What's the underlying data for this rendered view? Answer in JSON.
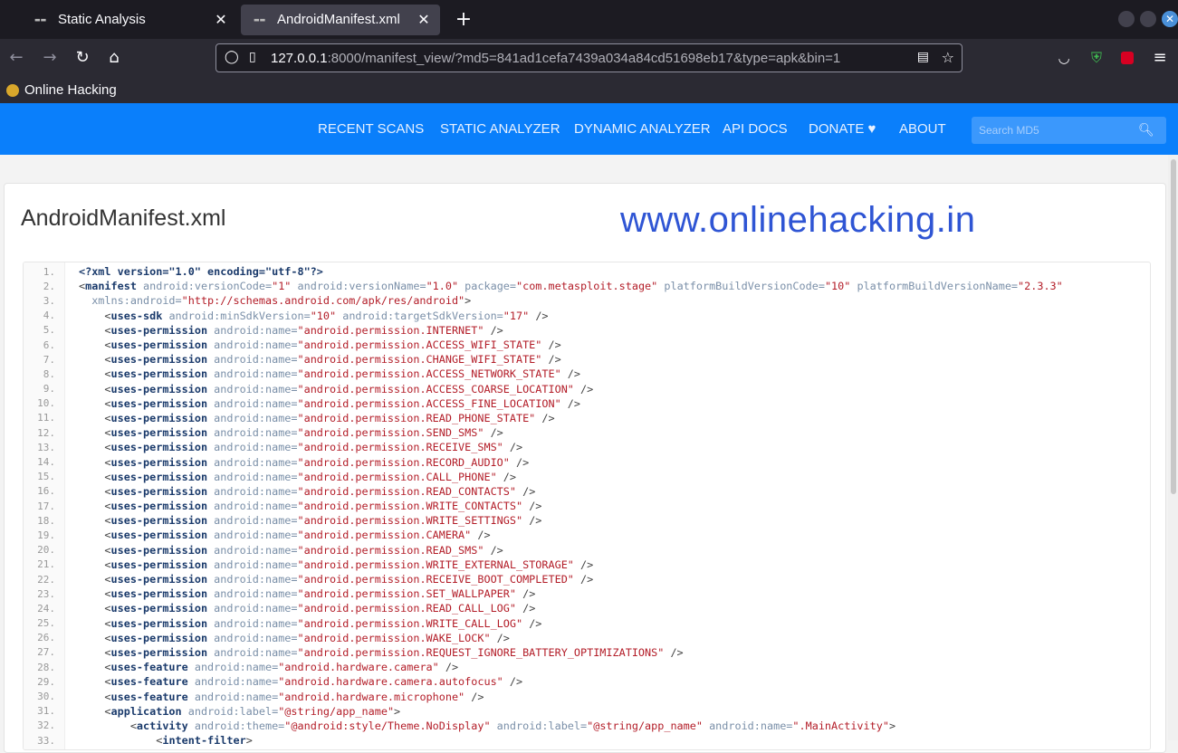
{
  "browser": {
    "tabs": [
      {
        "title": "Static Analysis",
        "active": false
      },
      {
        "title": "AndroidManifest.xml",
        "active": true
      }
    ],
    "url_host": "127.0.0.1",
    "url_rest": ":8000/manifest_view/?md5=841ad1cefa7439a034a84cd51698eb17&type=apk&bin=1",
    "bookmark": "Online Hacking"
  },
  "site": {
    "nav": [
      "RECENT SCANS",
      "STATIC ANALYZER",
      "DYNAMIC ANALYZER",
      "API DOCS",
      "DONATE ♥",
      "ABOUT"
    ],
    "search_placeholder": "Search MD5"
  },
  "page": {
    "title": "AndroidManifest.xml",
    "watermark": "www.onlinehacking.in"
  },
  "code_lines": [
    [
      [
        "decl",
        "<?xml version=\"1.0\" encoding=\"utf-8\"?>"
      ]
    ],
    [
      [
        "punct",
        "<"
      ],
      [
        "tag",
        "manifest"
      ],
      [
        "attr",
        " android:versionCode="
      ],
      [
        "val",
        "\"1\""
      ],
      [
        "attr",
        " android:versionName="
      ],
      [
        "val",
        "\"1.0\""
      ],
      [
        "attr",
        " package="
      ],
      [
        "val",
        "\"com.metasploit.stage\""
      ],
      [
        "attr",
        " platformBuildVersionCode="
      ],
      [
        "val",
        "\"10\""
      ],
      [
        "attr",
        " platformBuildVersionName="
      ],
      [
        "val",
        "\"2.3.3\""
      ]
    ],
    [
      [
        "attr",
        "  xmlns:android="
      ],
      [
        "val",
        "\"http://schemas.android.com/apk/res/android\""
      ],
      [
        "punct",
        ">"
      ]
    ],
    [
      [
        "punct",
        "    <"
      ],
      [
        "tag",
        "uses-sdk"
      ],
      [
        "attr",
        " android:minSdkVersion="
      ],
      [
        "val",
        "\"10\""
      ],
      [
        "attr",
        " android:targetSdkVersion="
      ],
      [
        "val",
        "\"17\""
      ],
      [
        "punct",
        " />"
      ]
    ],
    [
      [
        "punct",
        "    <"
      ],
      [
        "tag",
        "uses-permission"
      ],
      [
        "attr",
        " android:name="
      ],
      [
        "val",
        "\"android.permission.INTERNET\""
      ],
      [
        "punct",
        " />"
      ]
    ],
    [
      [
        "punct",
        "    <"
      ],
      [
        "tag",
        "uses-permission"
      ],
      [
        "attr",
        " android:name="
      ],
      [
        "val",
        "\"android.permission.ACCESS_WIFI_STATE\""
      ],
      [
        "punct",
        " />"
      ]
    ],
    [
      [
        "punct",
        "    <"
      ],
      [
        "tag",
        "uses-permission"
      ],
      [
        "attr",
        " android:name="
      ],
      [
        "val",
        "\"android.permission.CHANGE_WIFI_STATE\""
      ],
      [
        "punct",
        " />"
      ]
    ],
    [
      [
        "punct",
        "    <"
      ],
      [
        "tag",
        "uses-permission"
      ],
      [
        "attr",
        " android:name="
      ],
      [
        "val",
        "\"android.permission.ACCESS_NETWORK_STATE\""
      ],
      [
        "punct",
        " />"
      ]
    ],
    [
      [
        "punct",
        "    <"
      ],
      [
        "tag",
        "uses-permission"
      ],
      [
        "attr",
        " android:name="
      ],
      [
        "val",
        "\"android.permission.ACCESS_COARSE_LOCATION\""
      ],
      [
        "punct",
        " />"
      ]
    ],
    [
      [
        "punct",
        "    <"
      ],
      [
        "tag",
        "uses-permission"
      ],
      [
        "attr",
        " android:name="
      ],
      [
        "val",
        "\"android.permission.ACCESS_FINE_LOCATION\""
      ],
      [
        "punct",
        " />"
      ]
    ],
    [
      [
        "punct",
        "    <"
      ],
      [
        "tag",
        "uses-permission"
      ],
      [
        "attr",
        " android:name="
      ],
      [
        "val",
        "\"android.permission.READ_PHONE_STATE\""
      ],
      [
        "punct",
        " />"
      ]
    ],
    [
      [
        "punct",
        "    <"
      ],
      [
        "tag",
        "uses-permission"
      ],
      [
        "attr",
        " android:name="
      ],
      [
        "val",
        "\"android.permission.SEND_SMS\""
      ],
      [
        "punct",
        " />"
      ]
    ],
    [
      [
        "punct",
        "    <"
      ],
      [
        "tag",
        "uses-permission"
      ],
      [
        "attr",
        " android:name="
      ],
      [
        "val",
        "\"android.permission.RECEIVE_SMS\""
      ],
      [
        "punct",
        " />"
      ]
    ],
    [
      [
        "punct",
        "    <"
      ],
      [
        "tag",
        "uses-permission"
      ],
      [
        "attr",
        " android:name="
      ],
      [
        "val",
        "\"android.permission.RECORD_AUDIO\""
      ],
      [
        "punct",
        " />"
      ]
    ],
    [
      [
        "punct",
        "    <"
      ],
      [
        "tag",
        "uses-permission"
      ],
      [
        "attr",
        " android:name="
      ],
      [
        "val",
        "\"android.permission.CALL_PHONE\""
      ],
      [
        "punct",
        " />"
      ]
    ],
    [
      [
        "punct",
        "    <"
      ],
      [
        "tag",
        "uses-permission"
      ],
      [
        "attr",
        " android:name="
      ],
      [
        "val",
        "\"android.permission.READ_CONTACTS\""
      ],
      [
        "punct",
        " />"
      ]
    ],
    [
      [
        "punct",
        "    <"
      ],
      [
        "tag",
        "uses-permission"
      ],
      [
        "attr",
        " android:name="
      ],
      [
        "val",
        "\"android.permission.WRITE_CONTACTS\""
      ],
      [
        "punct",
        " />"
      ]
    ],
    [
      [
        "punct",
        "    <"
      ],
      [
        "tag",
        "uses-permission"
      ],
      [
        "attr",
        " android:name="
      ],
      [
        "val",
        "\"android.permission.WRITE_SETTINGS\""
      ],
      [
        "punct",
        " />"
      ]
    ],
    [
      [
        "punct",
        "    <"
      ],
      [
        "tag",
        "uses-permission"
      ],
      [
        "attr",
        " android:name="
      ],
      [
        "val",
        "\"android.permission.CAMERA\""
      ],
      [
        "punct",
        " />"
      ]
    ],
    [
      [
        "punct",
        "    <"
      ],
      [
        "tag",
        "uses-permission"
      ],
      [
        "attr",
        " android:name="
      ],
      [
        "val",
        "\"android.permission.READ_SMS\""
      ],
      [
        "punct",
        " />"
      ]
    ],
    [
      [
        "punct",
        "    <"
      ],
      [
        "tag",
        "uses-permission"
      ],
      [
        "attr",
        " android:name="
      ],
      [
        "val",
        "\"android.permission.WRITE_EXTERNAL_STORAGE\""
      ],
      [
        "punct",
        " />"
      ]
    ],
    [
      [
        "punct",
        "    <"
      ],
      [
        "tag",
        "uses-permission"
      ],
      [
        "attr",
        " android:name="
      ],
      [
        "val",
        "\"android.permission.RECEIVE_BOOT_COMPLETED\""
      ],
      [
        "punct",
        " />"
      ]
    ],
    [
      [
        "punct",
        "    <"
      ],
      [
        "tag",
        "uses-permission"
      ],
      [
        "attr",
        " android:name="
      ],
      [
        "val",
        "\"android.permission.SET_WALLPAPER\""
      ],
      [
        "punct",
        " />"
      ]
    ],
    [
      [
        "punct",
        "    <"
      ],
      [
        "tag",
        "uses-permission"
      ],
      [
        "attr",
        " android:name="
      ],
      [
        "val",
        "\"android.permission.READ_CALL_LOG\""
      ],
      [
        "punct",
        " />"
      ]
    ],
    [
      [
        "punct",
        "    <"
      ],
      [
        "tag",
        "uses-permission"
      ],
      [
        "attr",
        " android:name="
      ],
      [
        "val",
        "\"android.permission.WRITE_CALL_LOG\""
      ],
      [
        "punct",
        " />"
      ]
    ],
    [
      [
        "punct",
        "    <"
      ],
      [
        "tag",
        "uses-permission"
      ],
      [
        "attr",
        " android:name="
      ],
      [
        "val",
        "\"android.permission.WAKE_LOCK\""
      ],
      [
        "punct",
        " />"
      ]
    ],
    [
      [
        "punct",
        "    <"
      ],
      [
        "tag",
        "uses-permission"
      ],
      [
        "attr",
        " android:name="
      ],
      [
        "val",
        "\"android.permission.REQUEST_IGNORE_BATTERY_OPTIMIZATIONS\""
      ],
      [
        "punct",
        " />"
      ]
    ],
    [
      [
        "punct",
        "    <"
      ],
      [
        "tag",
        "uses-feature"
      ],
      [
        "attr",
        " android:name="
      ],
      [
        "val",
        "\"android.hardware.camera\""
      ],
      [
        "punct",
        " />"
      ]
    ],
    [
      [
        "punct",
        "    <"
      ],
      [
        "tag",
        "uses-feature"
      ],
      [
        "attr",
        " android:name="
      ],
      [
        "val",
        "\"android.hardware.camera.autofocus\""
      ],
      [
        "punct",
        " />"
      ]
    ],
    [
      [
        "punct",
        "    <"
      ],
      [
        "tag",
        "uses-feature"
      ],
      [
        "attr",
        " android:name="
      ],
      [
        "val",
        "\"android.hardware.microphone\""
      ],
      [
        "punct",
        " />"
      ]
    ],
    [
      [
        "punct",
        "    <"
      ],
      [
        "tag",
        "application"
      ],
      [
        "attr",
        " android:label="
      ],
      [
        "val",
        "\"@string/app_name\""
      ],
      [
        "punct",
        ">"
      ]
    ],
    [
      [
        "punct",
        "        <"
      ],
      [
        "tag",
        "activity"
      ],
      [
        "attr",
        " android:theme="
      ],
      [
        "val",
        "\"@android:style/Theme.NoDisplay\""
      ],
      [
        "attr",
        " android:label="
      ],
      [
        "val",
        "\"@string/app_name\""
      ],
      [
        "attr",
        " android:name="
      ],
      [
        "val",
        "\".MainActivity\""
      ],
      [
        "punct",
        ">"
      ]
    ],
    [
      [
        "punct",
        "            <"
      ],
      [
        "tag",
        "intent-filter"
      ],
      [
        "punct",
        ">"
      ]
    ]
  ]
}
